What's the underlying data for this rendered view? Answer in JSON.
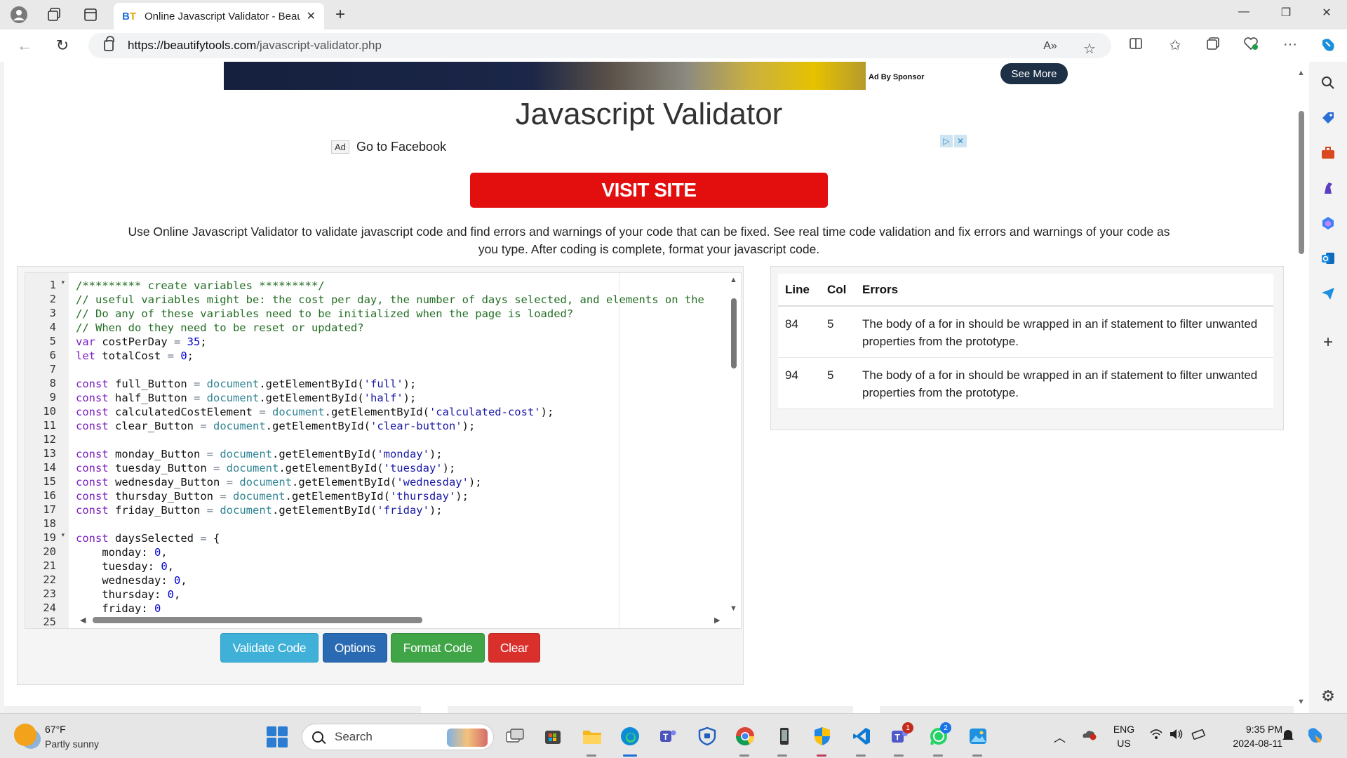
{
  "browser": {
    "tab_title": "Online Javascript Validator - Beautify Tools",
    "tab_favicon": "BT",
    "url_domain": "https://beautifytools.com",
    "url_path": "/javascript-validator.php",
    "read_aloud_label": "A»"
  },
  "ad": {
    "by_label": "Ad By",
    "sponsor_label": "Sponsor",
    "see_more": "See More",
    "ad_tag": "Ad",
    "go_to": "Go to Facebook",
    "visit_site": "VISIT SITE"
  },
  "page": {
    "title": "Javascript Validator",
    "description": "Use Online Javascript Validator to validate javascript code and find errors and warnings of your code that can be fixed. See real time code validation and fix errors and warnings of your code as you type. After coding is complete, format your javascript code."
  },
  "editor": {
    "lines": [
      {
        "n": "1",
        "fold": true
      },
      {
        "n": "2"
      },
      {
        "n": "3"
      },
      {
        "n": "4"
      },
      {
        "n": "5"
      },
      {
        "n": "6"
      },
      {
        "n": "7"
      },
      {
        "n": "8"
      },
      {
        "n": "9"
      },
      {
        "n": "10"
      },
      {
        "n": "11"
      },
      {
        "n": "12"
      },
      {
        "n": "13"
      },
      {
        "n": "14"
      },
      {
        "n": "15"
      },
      {
        "n": "16"
      },
      {
        "n": "17"
      },
      {
        "n": "18"
      },
      {
        "n": "19",
        "fold": true
      },
      {
        "n": "20"
      },
      {
        "n": "21"
      },
      {
        "n": "22"
      },
      {
        "n": "23"
      },
      {
        "n": "24"
      },
      {
        "n": "25"
      }
    ],
    "code": {
      "l1": "/********* create variables *********/",
      "l2": "// useful variables might be: the cost per day, the number of days selected, and elements on the",
      "l3": "// Do any of these variables need to be initialized when the page is loaded?",
      "l4": "// When do they need to be reset or updated?",
      "l5_kw": "var",
      "l5_id": " costPerDay ",
      "l5_op": "=",
      "l5_num": " 35",
      "l5_end": ";",
      "l6_kw": "let",
      "l6_id": " totalCost ",
      "l6_op": "=",
      "l6_num": " 0",
      "l6_end": ";",
      "l8": {
        "id": " full_Button ",
        "str": "'full'"
      },
      "l9": {
        "id": " half_Button ",
        "str": "'half'"
      },
      "l10": {
        "id": " calculatedCostElement ",
        "str": "'calculated-cost'"
      },
      "l11": {
        "id": " clear_Button ",
        "str": "'clear-button'"
      },
      "l13": {
        "id": " monday_Button ",
        "str": "'monday'"
      },
      "l14": {
        "id": " tuesday_Button ",
        "str": "'tuesday'"
      },
      "l15": {
        "id": " wednesday_Button ",
        "str": "'wednesday'"
      },
      "l16": {
        "id": " thursday_Button ",
        "str": "'thursday'"
      },
      "l17": {
        "id": " friday_Button ",
        "str": "'friday'"
      },
      "const_kw": "const",
      "assign": "=",
      "doc": " document",
      "method": ".getElementById(",
      "close": ");",
      "l19_id": " daysSelected ",
      "l19_brace": " {",
      "l20_key": "    monday: ",
      "l20_val": "0",
      "l20_end": ",",
      "l21_key": "    tuesday: ",
      "l21_val": "0",
      "l21_end": ",",
      "l22_key": "    wednesday: ",
      "l22_val": "0",
      "l22_end": ",",
      "l23_key": "    thursday: ",
      "l23_val": "0",
      "l23_end": ",",
      "l24_key": "    friday: ",
      "l24_val": "0"
    }
  },
  "buttons": {
    "validate": "Validate Code",
    "options": "Options",
    "format": "Format Code",
    "clear": "Clear"
  },
  "results": {
    "headers": [
      "Line",
      "Col",
      "Errors"
    ],
    "rows": [
      {
        "line": "84",
        "col": "5",
        "error": "The body of a for in should be wrapped in an if statement to filter unwanted properties from the prototype."
      },
      {
        "line": "94",
        "col": "5",
        "error": "The body of a for in should be wrapped in an if statement to filter unwanted properties from the prototype."
      }
    ]
  },
  "taskbar": {
    "weather_temp": "67°F",
    "weather_desc": "Partly sunny",
    "search_placeholder": "Search",
    "teams_badge": "1",
    "whatsapp_badge": "2",
    "lang": "ENG",
    "region": "US",
    "time": "9:35 PM",
    "date": "2024-08-11"
  },
  "colors": {
    "validate": "#3fb1d8",
    "options": "#2a6ab3",
    "format": "#40a546",
    "clear": "#d9302c",
    "visit_site": "#e30e0e"
  }
}
